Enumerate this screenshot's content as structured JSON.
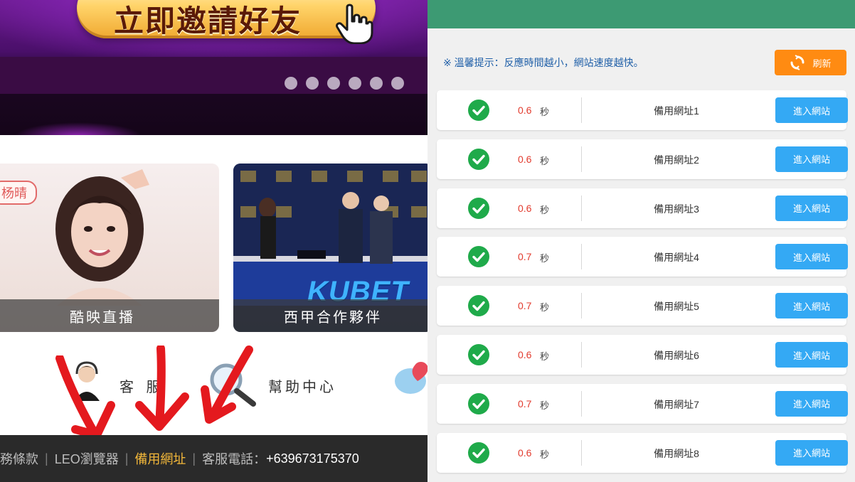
{
  "banner": {
    "invite_text": "立即邀請好友",
    "slide_count": 6
  },
  "cards": [
    {
      "tag": "杨晴",
      "caption": "酷映直播"
    },
    {
      "brand": "KUBET",
      "caption": "西甲合作夥伴"
    }
  ],
  "quick_links": {
    "service_label": "客 服",
    "help_label": "幫助中心"
  },
  "footer": {
    "terms": "務條款",
    "sep": "|",
    "browser": "LEO瀏覽器",
    "backup": "備用網址",
    "phone_label": "客服電話：",
    "phone": "+639673175370"
  },
  "speedtest": {
    "tip": "※ 溫馨提示：反應時間越小，網站速度越快。",
    "refresh_label": "刷新",
    "unit": "秒",
    "enter_label": "進入網站",
    "rows": [
      {
        "time": "0.6",
        "name": "備用網址1"
      },
      {
        "time": "0.6",
        "name": "備用網址2"
      },
      {
        "time": "0.6",
        "name": "備用網址3"
      },
      {
        "time": "0.7",
        "name": "備用網址4"
      },
      {
        "time": "0.7",
        "name": "備用網址5"
      },
      {
        "time": "0.6",
        "name": "備用網址6"
      },
      {
        "time": "0.7",
        "name": "備用網址7"
      },
      {
        "time": "0.6",
        "name": "備用網址8"
      }
    ]
  },
  "colors": {
    "topbar": "#3d9a73",
    "refresh": "#ff8b12",
    "enter_button": "#34a9f4",
    "check": "#1faa4a",
    "time_text": "#e23b2e",
    "footer_highlight": "#f2b73a"
  }
}
